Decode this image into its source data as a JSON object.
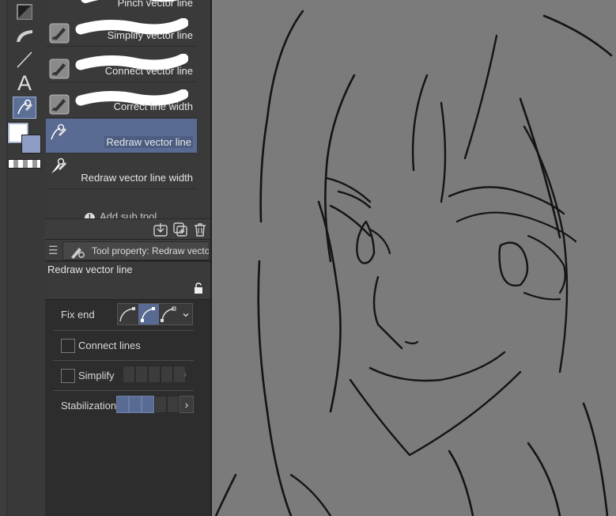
{
  "colors": {
    "accent": "#5a6b93",
    "panel": "#3a3a3a",
    "canvas": "#7b7b7b",
    "main_color": "#ffffff",
    "sub_color": "#8e9dc3"
  },
  "toolbar": {
    "tools": [
      {
        "icon": "fill-square-icon"
      },
      {
        "icon": "curve-ruler-icon"
      },
      {
        "icon": "straight-line-icon"
      },
      {
        "icon": "text-tool-icon",
        "glyph": "A"
      },
      {
        "icon": "redraw-line-tool-icon",
        "active": true
      }
    ]
  },
  "subtools": {
    "items": [
      {
        "label": "Pinch vector line",
        "icon": "brush-icon"
      },
      {
        "label": "Simplify vector line",
        "icon": "brush-icon"
      },
      {
        "label": "Connect vector line",
        "icon": "brush-icon"
      },
      {
        "label": "Correct line width",
        "icon": "brush-icon"
      },
      {
        "label": "Redraw vector line",
        "icon": "redraw-brush-icon",
        "selected": true
      },
      {
        "label": "Redraw vector line width",
        "icon": "redraw-width-icon"
      }
    ],
    "add_label": "Add sub tool"
  },
  "tool_property": {
    "header_title": "Tool property: Redraw vecto",
    "tool_name": "Redraw vector line",
    "fix_end_label": "Fix end",
    "connect_lines_label": "Connect lines",
    "simplify_label": "Simplify",
    "stabilization_label": "Stabilization",
    "stabilization_level": 3,
    "stabilization_max": 5
  }
}
